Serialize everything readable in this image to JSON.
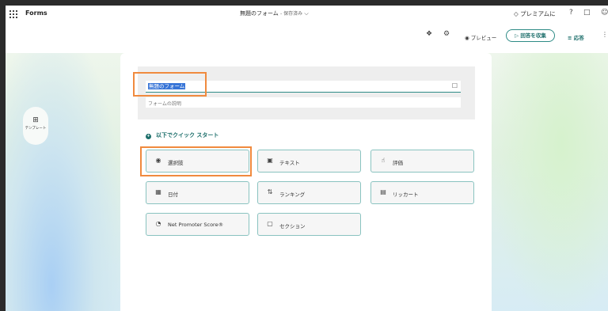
{
  "topbar": {
    "app_name": "Forms",
    "form_title": "無題のフォーム",
    "saved_status": "- 保存済み",
    "premium_label": "プレミアムに",
    "help_label": "?"
  },
  "toolbar": {
    "preview_label": "プレビュー",
    "collect_label": "回答を収集",
    "responses_label": "応答"
  },
  "sidebar": {
    "template_label": "テンプレート"
  },
  "form": {
    "title_value": "無題のフォーム",
    "description_placeholder": "フォームの説明"
  },
  "quick_start": {
    "heading": "以下でクイック スタート",
    "options": [
      {
        "label": "選択肢",
        "icon": "radio-icon"
      },
      {
        "label": "テキスト",
        "icon": "text-icon"
      },
      {
        "label": "評価",
        "icon": "thumbs-up-icon"
      },
      {
        "label": "日付",
        "icon": "calendar-icon"
      },
      {
        "label": "ランキング",
        "icon": "ranking-icon"
      },
      {
        "label": "リッカート",
        "icon": "likert-icon"
      },
      {
        "label": "Net Promoter Score®",
        "icon": "nps-icon"
      },
      {
        "label": "セクション",
        "icon": "section-icon"
      }
    ]
  },
  "colors": {
    "accent": "#1d6f6b",
    "highlight_box": "#f08a3e",
    "selection": "#3875d7"
  }
}
